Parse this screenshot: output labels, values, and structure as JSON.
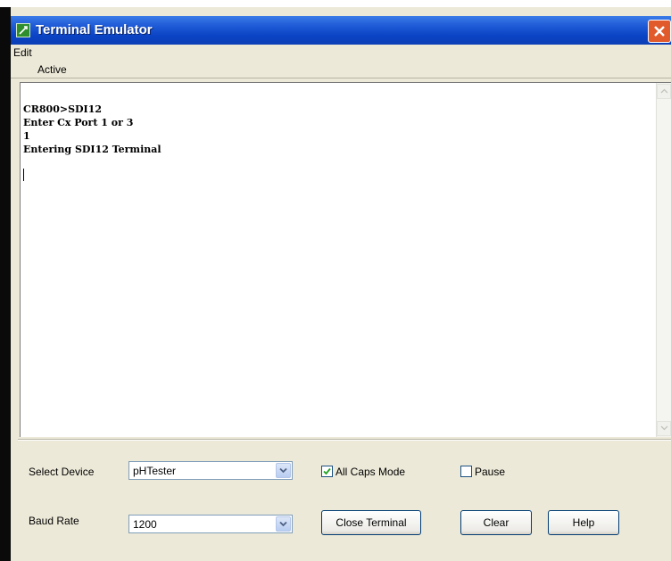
{
  "window": {
    "title": "Terminal Emulator",
    "title_bar_color": "#0a43c4",
    "app_icon": "terminal-app-icon",
    "close_icon": "close-icon"
  },
  "menu": {
    "edit_label": "Edit"
  },
  "tab": {
    "active_label": "Active"
  },
  "terminal": {
    "lines": [
      "CR800>SDI12",
      "Enter Cx Port 1 or 3",
      "1",
      "Entering SDI12 Terminal"
    ]
  },
  "controls": {
    "select_device_label": "Select Device",
    "select_device_value": "pHTester",
    "baud_rate_label": "Baud Rate",
    "baud_rate_value": "1200",
    "all_caps_label": "All Caps Mode",
    "all_caps_checked": true,
    "pause_label": "Pause",
    "pause_checked": false,
    "close_terminal_label": "Close Terminal",
    "clear_label": "Clear",
    "help_label": "Help"
  }
}
